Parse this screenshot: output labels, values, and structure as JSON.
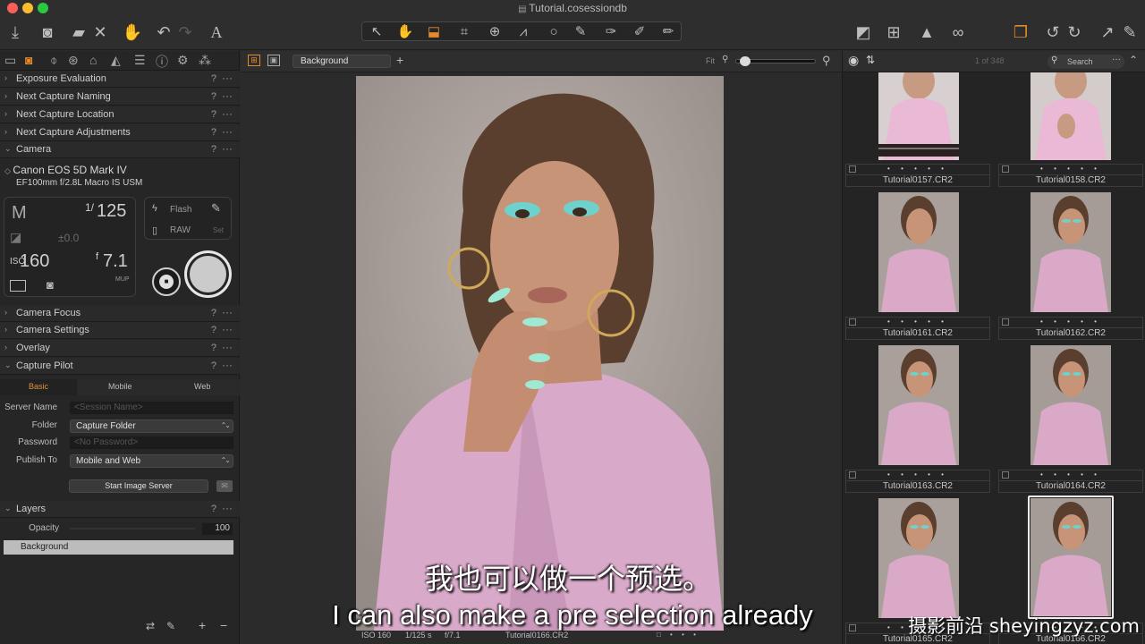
{
  "window": {
    "title": "Tutorial.cosessiondb"
  },
  "toolbar": {
    "left_icons": [
      "download-icon",
      "camera-icon",
      "folder-import-icon",
      "close-icon",
      "hand-icon",
      "undo-icon",
      "redo-icon",
      "text-icon"
    ],
    "cursor_tools": [
      "pointer-icon",
      "hand-icon",
      "crop-icon",
      "rotate-icon",
      "keystone-icon",
      "lines-icon",
      "circle-icon",
      "brush-icon",
      "picker-icon",
      "gradient-icon",
      "eraser-icon"
    ],
    "right_icons": [
      "compare-icon",
      "grid-icon",
      "warning-icon",
      "glasses-icon",
      "multi-view-icon",
      "rotate-left-icon",
      "rotate-right-icon",
      "export-icon"
    ]
  },
  "left_panel": {
    "sections_top": [
      "Exposure Evaluation",
      "Next Capture Naming",
      "Next Capture Location",
      "Next Capture Adjustments"
    ],
    "camera": {
      "title": "Camera",
      "model": "Canon EOS 5D Mark IV",
      "lens": "EF100mm f/2.8L Macro IS USM",
      "mode": "M",
      "shutter_num": "1/",
      "shutter_den": "125",
      "exposure_comp": "±0.0",
      "iso": "160",
      "aperture_prefix": "f",
      "aperture": "7.1",
      "flash_label": "Flash",
      "raw_label": "RAW",
      "set_label": "Set",
      "mup_label": "MUP"
    },
    "sections_mid": [
      "Camera Focus",
      "Camera Settings",
      "Overlay"
    ],
    "capture_pilot": {
      "title": "Capture Pilot",
      "tabs": [
        "Basic",
        "Mobile",
        "Web"
      ],
      "server_name_label": "Server Name",
      "server_name_placeholder": "<Session Name>",
      "folder_label": "Folder",
      "folder_value": "Capture Folder",
      "password_label": "Password",
      "password_placeholder": "<No Password>",
      "publish_label": "Publish To",
      "publish_value": "Mobile and Web",
      "start_button": "Start Image Server"
    },
    "layers": {
      "title": "Layers",
      "opacity_label": "Opacity",
      "opacity_value": "100",
      "background_layer": "Background"
    },
    "help": "?",
    "more": "···"
  },
  "viewer": {
    "variant_select": "Background",
    "fit_label": "Fit",
    "status": {
      "iso": "ISO 160",
      "shutter": "1/125 s",
      "aperture": "f/7.1",
      "filename": "Tutorial0166.CR2"
    }
  },
  "browser": {
    "count": "1 of 348",
    "search_placeholder": "Search",
    "dots": "• • • • •",
    "thumbs": [
      {
        "name": "Tutorial0157.CR2"
      },
      {
        "name": "Tutorial0158.CR2"
      },
      {
        "name": "Tutorial0161.CR2"
      },
      {
        "name": "Tutorial0162.CR2"
      },
      {
        "name": "Tutorial0163.CR2"
      },
      {
        "name": "Tutorial0164.CR2"
      },
      {
        "name": "Tutorial0165.CR2"
      },
      {
        "name": "Tutorial0166.CR2"
      }
    ]
  },
  "subtitles": {
    "zh": "我也可以做一个预选。",
    "en": "I can also make a pre selection already"
  },
  "watermark": "摄影前沿 sheyingzyz.com",
  "colors": {
    "accent": "#e48a2a",
    "panel": "#262626",
    "selection": "#ffffff"
  }
}
